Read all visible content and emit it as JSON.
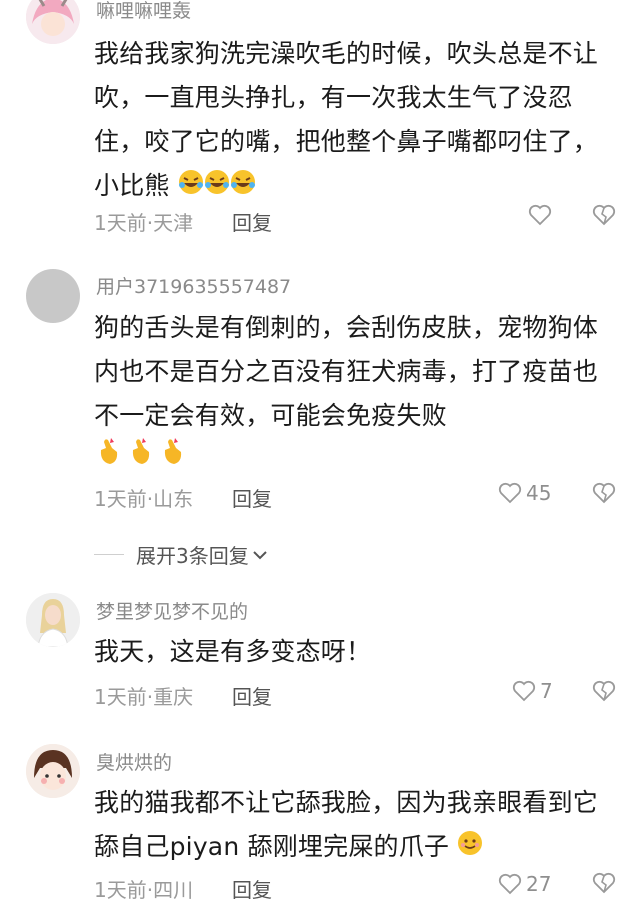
{
  "comments": [
    {
      "username": "嘛哩嘛哩轰",
      "text": "我给我家狗洗完澡吹毛的时候，吹头总是不让吹，一直甩头挣扎，有一次我太生气了没忍住，咬了它的嘴，把他整个鼻子嘴都叼住了，小比熊",
      "time_location": "1天前·天津",
      "reply_label": "回复",
      "like_count": ""
    },
    {
      "username": "用户3719635557487",
      "text": "狗的舌头是有倒刺的，会刮伤皮肤，宠物狗体内也不是百分之百没有狂犬病毒，打了疫苗也不一定会有效，可能会免疫失败",
      "time_location": "1天前·山东",
      "reply_label": "回复",
      "like_count": "45"
    },
    {
      "username": "梦里梦见梦不见的",
      "text": "我天，这是有多变态呀！",
      "time_location": "1天前·重庆",
      "reply_label": "回复",
      "like_count": "7"
    },
    {
      "username": "臭烘烘的",
      "text": "我的猫我都不让它舔我脸，因为我亲眼看到它舔自己piyan 舔刚埋完屎的爪子",
      "time_location": "1天前·四川",
      "reply_label": "回复",
      "like_count": "27"
    }
  ],
  "expand_replies_label": "展开3条回复",
  "icons": {
    "like": "heart-outline-icon",
    "dislike": "broken-heart-icon",
    "expand": "chevron-down-icon",
    "emoji_laugh": "rofl-emoji",
    "emoji_hand": "finger-heart-emoji",
    "emoji_smile": "smile-emoji"
  }
}
